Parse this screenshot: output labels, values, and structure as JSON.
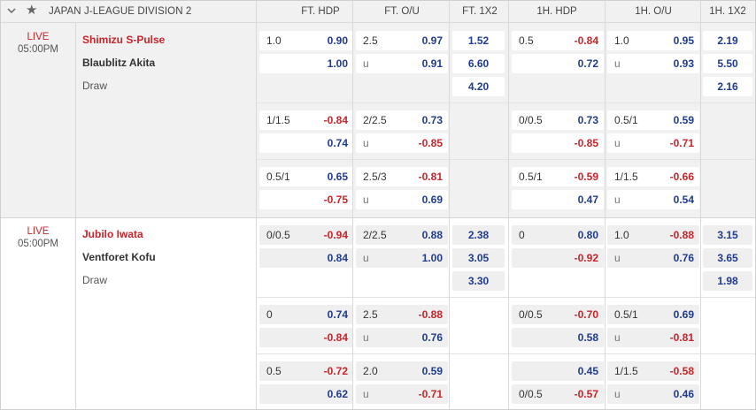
{
  "header": {
    "league": "JAPAN J-LEAGUE DIVISION 2",
    "columns": [
      "FT. HDP",
      "FT. O/U",
      "FT. 1X2",
      "1H. HDP",
      "1H. O/U",
      "1H. 1X2"
    ]
  },
  "icons": {
    "collapse": "chevron-down-icon",
    "favorite": "star-icon"
  },
  "colors": {
    "red": "#c8242a",
    "blue": "#1f3b8f",
    "header_bg": "#f1f1f1"
  },
  "matches": [
    {
      "status": "LIVE",
      "time": "05:00PM",
      "home": "Shimizu S-Pulse",
      "away": "Blaublitz Akita",
      "draw": "Draw",
      "ft_1x2": [
        "1.52",
        "6.60",
        "4.20"
      ],
      "h1_1x2": [
        "2.19",
        "5.50",
        "2.16"
      ],
      "lines": [
        {
          "ft_hdp": {
            "home_label": "1.0",
            "home": "0.90",
            "away_label": "",
            "away": "1.00"
          },
          "ft_ou": {
            "over_label": "2.5",
            "over": "0.97",
            "under_label": "u",
            "under": "0.91"
          },
          "h1_hdp": {
            "home_label": "0.5",
            "home": "-0.84",
            "away_label": "",
            "away": "0.72"
          },
          "h1_ou": {
            "over_label": "1.0",
            "over": "0.95",
            "under_label": "u",
            "under": "0.93"
          }
        },
        {
          "ft_hdp": {
            "home_label": "1/1.5",
            "home": "-0.84",
            "away_label": "",
            "away": "0.74"
          },
          "ft_ou": {
            "over_label": "2/2.5",
            "over": "0.73",
            "under_label": "u",
            "under": "-0.85"
          },
          "h1_hdp": {
            "home_label": "0/0.5",
            "home": "0.73",
            "away_label": "",
            "away": "-0.85"
          },
          "h1_ou": {
            "over_label": "0.5/1",
            "over": "0.59",
            "under_label": "u",
            "under": "-0.71"
          }
        },
        {
          "ft_hdp": {
            "home_label": "0.5/1",
            "home": "0.65",
            "away_label": "",
            "away": "-0.75"
          },
          "ft_ou": {
            "over_label": "2.5/3",
            "over": "-0.81",
            "under_label": "u",
            "under": "0.69"
          },
          "h1_hdp": {
            "home_label": "0.5/1",
            "home": "-0.59",
            "away_label": "",
            "away": "0.47"
          },
          "h1_ou": {
            "over_label": "1/1.5",
            "over": "-0.66",
            "under_label": "u",
            "under": "0.54"
          }
        }
      ]
    },
    {
      "status": "LIVE",
      "time": "05:00PM",
      "home": "Jubilo Iwata",
      "away": "Ventforet Kofu",
      "draw": "Draw",
      "ft_1x2": [
        "2.38",
        "3.05",
        "3.30"
      ],
      "h1_1x2": [
        "3.15",
        "3.65",
        "1.98"
      ],
      "lines": [
        {
          "ft_hdp": {
            "home_label": "0/0.5",
            "home": "-0.94",
            "away_label": "",
            "away": "0.84"
          },
          "ft_ou": {
            "over_label": "2/2.5",
            "over": "0.88",
            "under_label": "u",
            "under": "1.00"
          },
          "h1_hdp": {
            "home_label": "0",
            "home": "0.80",
            "away_label": "",
            "away": "-0.92"
          },
          "h1_ou": {
            "over_label": "1.0",
            "over": "-0.88",
            "under_label": "u",
            "under": "0.76"
          }
        },
        {
          "ft_hdp": {
            "home_label": "0",
            "home": "0.74",
            "away_label": "",
            "away": "-0.84"
          },
          "ft_ou": {
            "over_label": "2.5",
            "over": "-0.88",
            "under_label": "u",
            "under": "0.76"
          },
          "h1_hdp": {
            "home_label": "0/0.5",
            "home": "-0.70",
            "away_label": "",
            "away": "0.58"
          },
          "h1_ou": {
            "over_label": "0.5/1",
            "over": "0.69",
            "under_label": "u",
            "under": "-0.81"
          }
        },
        {
          "ft_hdp": {
            "home_label": "0.5",
            "home": "-0.72",
            "away_label": "",
            "away": "0.62"
          },
          "ft_ou": {
            "over_label": "2.0",
            "over": "0.59",
            "under_label": "u",
            "under": "-0.71"
          },
          "h1_hdp": {
            "home_label": "",
            "home": "0.45",
            "away_label": "0/0.5",
            "away": "-0.57"
          },
          "h1_ou": {
            "over_label": "1/1.5",
            "over": "-0.58",
            "under_label": "u",
            "under": "0.46"
          }
        }
      ]
    }
  ]
}
